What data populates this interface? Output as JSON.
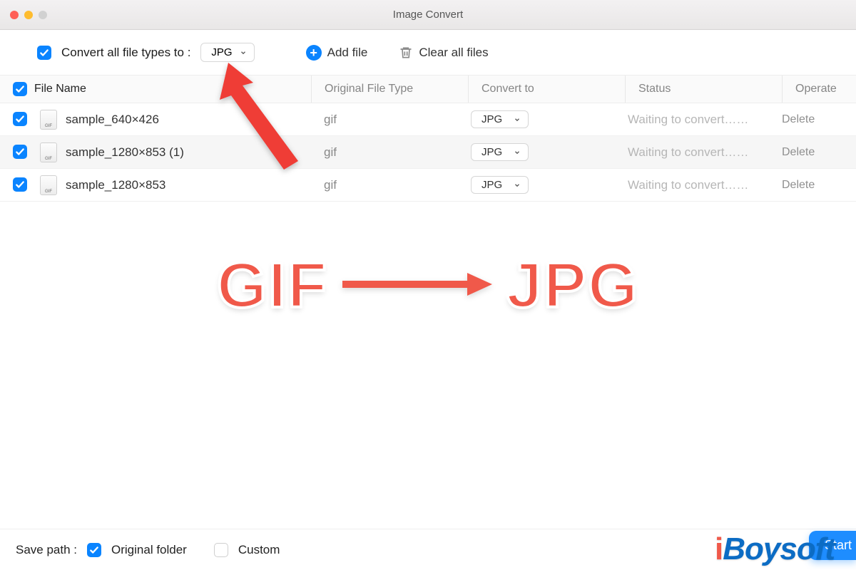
{
  "window": {
    "title": "Image Convert"
  },
  "toolbar": {
    "convert_all_label": "Convert all file types to :",
    "convert_all_value": "JPG",
    "add_file_label": "Add file",
    "clear_all_label": "Clear all files"
  },
  "columns": {
    "file_name": "File Name",
    "original_type": "Original File Type",
    "convert_to": "Convert to",
    "status": "Status",
    "operate": "Operate"
  },
  "rows": [
    {
      "name": "sample_640×426",
      "type": "gif",
      "convert": "JPG",
      "status": "Waiting to convert……",
      "op": "Delete"
    },
    {
      "name": "sample_1280×853 (1)",
      "type": "gif",
      "convert": "JPG",
      "status": "Waiting to convert……",
      "op": "Delete"
    },
    {
      "name": "sample_1280×853",
      "type": "gif",
      "convert": "JPG",
      "status": "Waiting to convert……",
      "op": "Delete"
    }
  ],
  "overlay": {
    "from": "GIF",
    "to": "JPG"
  },
  "footer": {
    "save_path_label": "Save path :",
    "original_folder": "Original folder",
    "custom": "Custom",
    "start": "Start"
  },
  "brand": "iBoysoft"
}
